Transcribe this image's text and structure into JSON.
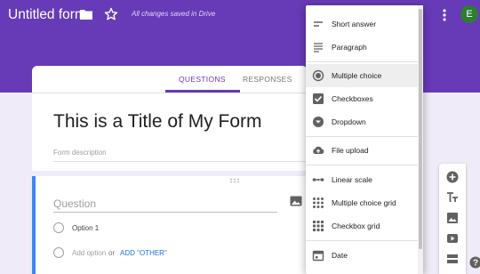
{
  "header": {
    "app_title": "Untitled form",
    "save_status": "All changes saved in Drive",
    "avatar_initial": "E"
  },
  "tabs": [
    {
      "label": "QUESTIONS",
      "active": true
    },
    {
      "label": "RESPONSES",
      "active": false
    }
  ],
  "form": {
    "title": "This is a Title of My Form",
    "description_placeholder": "Form description"
  },
  "question": {
    "placeholder": "Question",
    "option_1": "Option 1",
    "add_option": "Add option",
    "or": "or",
    "add_other": "ADD \"OTHER\""
  },
  "menu": {
    "items": [
      {
        "label": "Short answer",
        "icon": "short-answer-icon"
      },
      {
        "label": "Paragraph",
        "icon": "paragraph-icon"
      },
      {
        "label": "Multiple choice",
        "icon": "radio-button-icon",
        "selected": true
      },
      {
        "label": "Checkboxes",
        "icon": "checkbox-icon"
      },
      {
        "label": "Dropdown",
        "icon": "dropdown-icon"
      },
      {
        "label": "File upload",
        "icon": "cloud-upload-icon"
      },
      {
        "label": "Linear scale",
        "icon": "linear-scale-icon"
      },
      {
        "label": "Multiple choice grid",
        "icon": "grid-icon"
      },
      {
        "label": "Checkbox grid",
        "icon": "checkbox-grid-icon"
      },
      {
        "label": "Date",
        "icon": "calendar-icon"
      }
    ]
  },
  "colors": {
    "header": "#673ab7",
    "background": "#f0ebf8",
    "active_tab": "#673ab7",
    "question_accent": "#4285f4",
    "avatar": "#2e7d32"
  },
  "toolbar_icons": [
    "add-question-icon",
    "add-title-icon",
    "add-image-icon",
    "add-video-icon",
    "add-section-icon"
  ]
}
